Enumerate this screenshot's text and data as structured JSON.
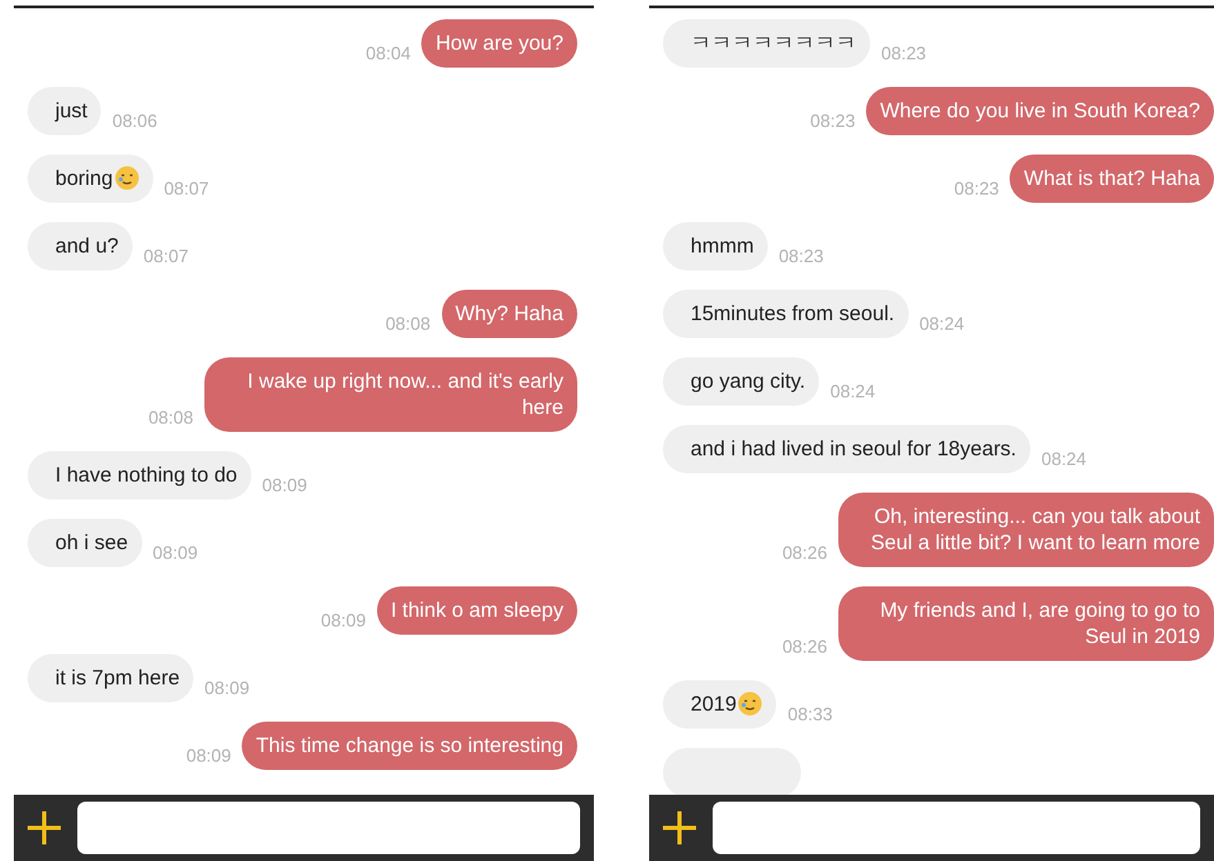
{
  "panels": [
    {
      "messages": [
        {
          "kind": "sent",
          "text": "How are you?",
          "time": "08:04"
        },
        {
          "kind": "received",
          "text": "just",
          "time": "08:06"
        },
        {
          "kind": "received",
          "text": "boring",
          "emoji": true,
          "time": "08:07"
        },
        {
          "kind": "received",
          "text": "and u?",
          "time": "08:07"
        },
        {
          "kind": "sent",
          "text": "Why? Haha",
          "time": "08:08"
        },
        {
          "kind": "sent",
          "text": "I wake up right now... and it's early here",
          "time": "08:08"
        },
        {
          "kind": "received",
          "text": "I have nothing to do",
          "time": "08:09"
        },
        {
          "kind": "received",
          "text": "oh i see",
          "time": "08:09"
        },
        {
          "kind": "sent",
          "text": "I think o am sleepy",
          "time": "08:09"
        },
        {
          "kind": "received",
          "text": "it is 7pm here",
          "time": "08:09"
        },
        {
          "kind": "sent",
          "text": "This time change is so interesting",
          "time": "08:09"
        }
      ]
    },
    {
      "messages": [
        {
          "kind": "received",
          "text": "ㅋㅋㅋㅋㅋㅋㅋㅋ",
          "time": "08:23"
        },
        {
          "kind": "sent",
          "text": "Where do you live in South Korea?",
          "time": "08:23"
        },
        {
          "kind": "sent",
          "text": "What is that? Haha",
          "time": "08:23"
        },
        {
          "kind": "received",
          "text": "hmmm",
          "time": "08:23"
        },
        {
          "kind": "received",
          "text": "15minutes from seoul.",
          "time": "08:24"
        },
        {
          "kind": "received",
          "text": "go yang city.",
          "time": "08:24"
        },
        {
          "kind": "received",
          "text": "and i had lived in seoul for 18years.",
          "time": "08:24"
        },
        {
          "kind": "sent",
          "text": "Oh, interesting... can you talk about Seul a little bit? I want to learn more",
          "time": "08:26"
        },
        {
          "kind": "sent",
          "text": "My friends and I, are going to go to Seul in 2019",
          "time": "08:26"
        },
        {
          "kind": "received",
          "text": "2019",
          "emoji": true,
          "time": "08:33"
        },
        {
          "kind": "received"
        }
      ]
    }
  ]
}
